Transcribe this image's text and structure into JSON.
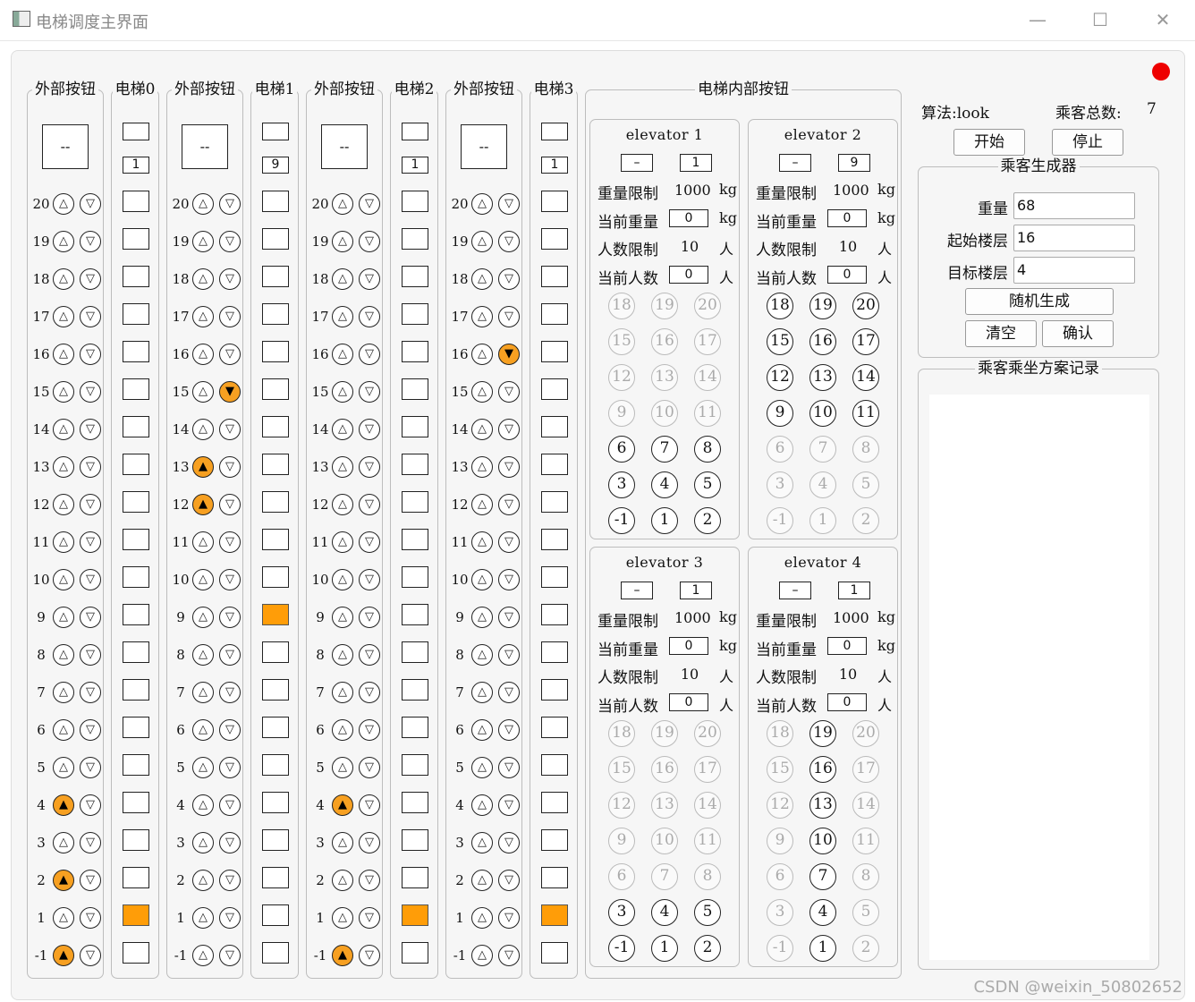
{
  "window": {
    "title": "电梯调度主界面",
    "minimize": "—",
    "maximize": "☐",
    "close": "✕"
  },
  "floors": [
    "20",
    "19",
    "18",
    "17",
    "16",
    "15",
    "14",
    "13",
    "12",
    "11",
    "10",
    "9",
    "8",
    "7",
    "6",
    "5",
    "4",
    "3",
    "2",
    "1",
    "-1"
  ],
  "columns": [
    {
      "ext_title": "外部按钮",
      "display": "--",
      "elev_title": "电梯0",
      "elev_floor": "1",
      "car_position": "1",
      "up_lit": [
        "4",
        "2",
        "-1"
      ],
      "down_lit": []
    },
    {
      "ext_title": "外部按钮",
      "display": "--",
      "elev_title": "电梯1",
      "elev_floor": "9",
      "car_position": "9",
      "up_lit": [
        "13",
        "12"
      ],
      "down_lit": [
        "15"
      ]
    },
    {
      "ext_title": "外部按钮",
      "display": "--",
      "elev_title": "电梯2",
      "elev_floor": "1",
      "car_position": "1",
      "up_lit": [
        "4",
        "-1"
      ],
      "down_lit": []
    },
    {
      "ext_title": "外部按钮",
      "display": "--",
      "elev_title": "电梯3",
      "elev_floor": "1",
      "car_position": "1",
      "up_lit": [],
      "down_lit": [
        "16"
      ]
    }
  ],
  "inner_panel": {
    "title": "电梯内部按钮",
    "labels": {
      "weight_limit": "重量限制",
      "current_weight": "当前重量",
      "people_limit": "人数限制",
      "current_people": "当前人数",
      "kg": "kg",
      "person": "人"
    },
    "elevators": [
      {
        "name": "elevator 1",
        "direction": "–",
        "floor": "1",
        "weight_limit": "1000",
        "current_weight": "0",
        "people_limit": "10",
        "current_people": "0",
        "enabled": [
          "6",
          "7",
          "8",
          "3",
          "4",
          "5",
          "-1",
          "1",
          "2"
        ]
      },
      {
        "name": "elevator 2",
        "direction": "–",
        "floor": "9",
        "weight_limit": "1000",
        "current_weight": "0",
        "people_limit": "10",
        "current_people": "0",
        "enabled": [
          "18",
          "19",
          "20",
          "15",
          "16",
          "17",
          "12",
          "13",
          "14",
          "9",
          "10",
          "11"
        ]
      },
      {
        "name": "elevator 3",
        "direction": "–",
        "floor": "1",
        "weight_limit": "1000",
        "current_weight": "0",
        "people_limit": "10",
        "current_people": "0",
        "enabled": [
          "3",
          "4",
          "5",
          "-1",
          "1",
          "2"
        ]
      },
      {
        "name": "elevator 4",
        "direction": "–",
        "floor": "1",
        "weight_limit": "1000",
        "current_weight": "0",
        "people_limit": "10",
        "current_people": "0",
        "enabled": [
          "19",
          "16",
          "13",
          "10",
          "7",
          "4",
          "1"
        ]
      }
    ],
    "button_grid": [
      [
        "18",
        "19",
        "20"
      ],
      [
        "15",
        "16",
        "17"
      ],
      [
        "12",
        "13",
        "14"
      ],
      [
        "9",
        "10",
        "11"
      ],
      [
        "6",
        "7",
        "8"
      ],
      [
        "3",
        "4",
        "5"
      ],
      [
        "-1",
        "1",
        "2"
      ]
    ]
  },
  "right": {
    "algorithm_label": "算法:look",
    "total_label": "乘客总数:",
    "total_value": "7",
    "start": "开始",
    "stop": "停止",
    "generator": {
      "title": "乘客生成器",
      "weight_label": "重量",
      "weight_value": "68",
      "start_label": "起始楼层",
      "start_value": "16",
      "target_label": "目标楼层",
      "target_value": "4",
      "random": "随机生成",
      "clear": "清空",
      "confirm": "确认"
    },
    "record_title": "乘客乘坐方案记录"
  },
  "status_color": "#ee0000",
  "accent_color": "#ff9d08",
  "watermark": "CSDN @weixin_50802652"
}
